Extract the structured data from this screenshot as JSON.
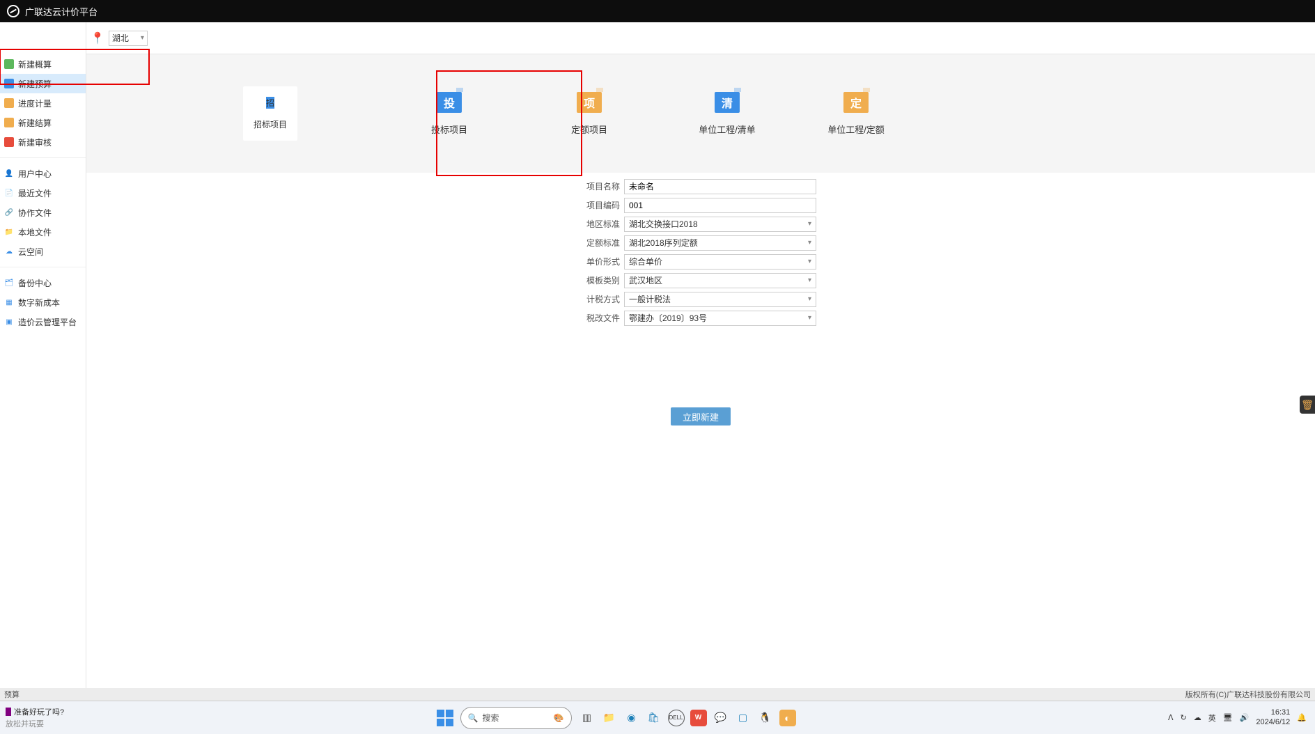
{
  "titlebar": {
    "title": "广联达云计价平台"
  },
  "region": {
    "selected": "湖北"
  },
  "sidebar": {
    "group1": [
      {
        "label": "新建概算",
        "iconClass": "green"
      },
      {
        "label": "新建预算",
        "iconClass": "blue",
        "active": true
      },
      {
        "label": "进度计量",
        "iconClass": "orange"
      },
      {
        "label": "新建结算",
        "iconClass": "orange"
      },
      {
        "label": "新建审核",
        "iconClass": "red"
      }
    ],
    "group2": [
      {
        "label": "用户中心",
        "iconClass": "user",
        "glyph": "👤"
      },
      {
        "label": "最近文件",
        "iconClass": "cblue",
        "glyph": "📄"
      },
      {
        "label": "协作文件",
        "iconClass": "cblue",
        "glyph": "🔗"
      },
      {
        "label": "本地文件",
        "iconClass": "cblue",
        "glyph": "📁"
      },
      {
        "label": "云空间",
        "iconClass": "cblue",
        "glyph": "☁"
      }
    ],
    "group3": [
      {
        "label": "备份中心",
        "iconClass": "cblue",
        "glyph": "🗂"
      },
      {
        "label": "数字新成本",
        "iconClass": "cblue",
        "glyph": "▦"
      },
      {
        "label": "造价云管理平台",
        "iconClass": "cblue",
        "glyph": "▣"
      }
    ]
  },
  "cards": [
    {
      "glyph": "招",
      "label": "招标项目",
      "cls": "g-招"
    },
    {
      "glyph": "投",
      "label": "投标项目",
      "cls": "g-投"
    },
    {
      "glyph": "项",
      "label": "定额项目",
      "cls": "g-项"
    },
    {
      "glyph": "清",
      "label": "单位工程/清单",
      "cls": "g-清"
    },
    {
      "glyph": "定",
      "label": "单位工程/定额",
      "cls": "g-定"
    }
  ],
  "form": {
    "projectNameLabel": "项目名称",
    "projectName": "未命名",
    "projectCodeLabel": "项目编码",
    "projectCode": "001",
    "regionStdLabel": "地区标准",
    "regionStd": "湖北交换接口2018",
    "quotaStdLabel": "定额标准",
    "quotaStd": "湖北2018序列定额",
    "priceFormLabel": "单价形式",
    "priceForm": "综合单价",
    "templateLabel": "模板类别",
    "template": "武汉地区",
    "taxMethodLabel": "计税方式",
    "taxMethod": "一般计税法",
    "taxDocLabel": "税改文件",
    "taxDoc": "鄂建办〔2019〕93号",
    "createBtn": "立即新建"
  },
  "footer": {
    "left": "预算",
    "right": "版权所有(C)广联达科技股份有限公司"
  },
  "taskbar": {
    "newsLine1": "准备好玩了吗?",
    "newsLine2": "放松并玩耍",
    "search": "搜索",
    "time": "16:31",
    "date": "2024/6/12",
    "ime": "英"
  }
}
